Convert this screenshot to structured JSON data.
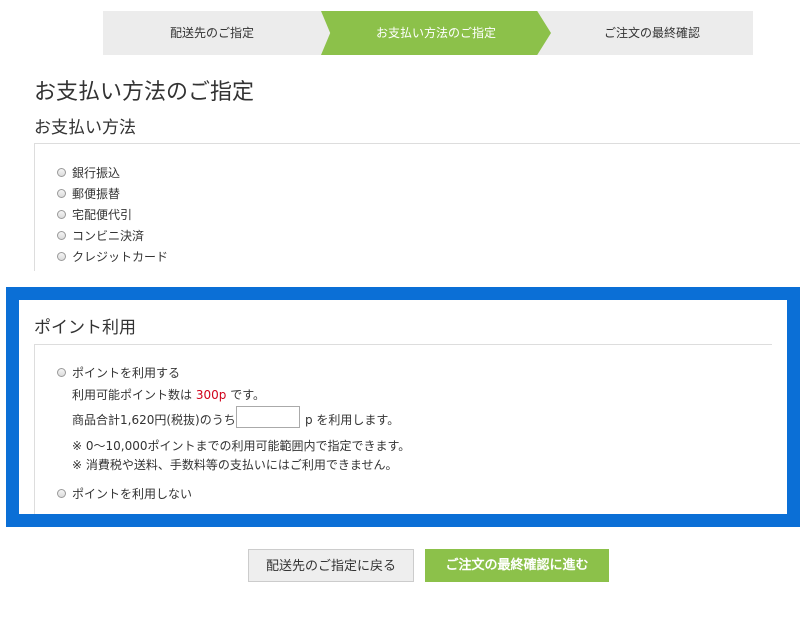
{
  "steps": [
    {
      "label": "配送先のご指定"
    },
    {
      "label": "お支払い方法のご指定"
    },
    {
      "label": "ご注文の最終確認"
    }
  ],
  "page_title": "お支払い方法のご指定",
  "payment": {
    "section_title": "お支払い方法",
    "options": [
      {
        "label": "銀行振込"
      },
      {
        "label": "郵便振替"
      },
      {
        "label": "宅配便代引"
      },
      {
        "label": "コンビニ決済"
      },
      {
        "label": "クレジットカード"
      }
    ]
  },
  "points": {
    "section_title": "ポイント利用",
    "use_label": "ポイントを利用する",
    "available_prefix": "利用可能ポイント数は",
    "available_value": "300p",
    "available_suffix": "です。",
    "subtotal_prefix": "商品合計1,620円(税抜)のうち",
    "input_value": "",
    "subtotal_suffix": "p を利用します。",
    "note1": "※ 0〜10,000ポイントまでの利用可能範囲内で指定できます。",
    "note2": "※ 消費税や送料、手数料等の支払いにはご利用できません。",
    "no_use_label": "ポイントを利用しない"
  },
  "buttons": {
    "back": "配送先のご指定に戻る",
    "next": "ご注文の最終確認に進む"
  },
  "colors": {
    "accent_green": "#8cc14a",
    "highlight_blue": "#0b6fd6",
    "point_red": "#d0021b"
  }
}
